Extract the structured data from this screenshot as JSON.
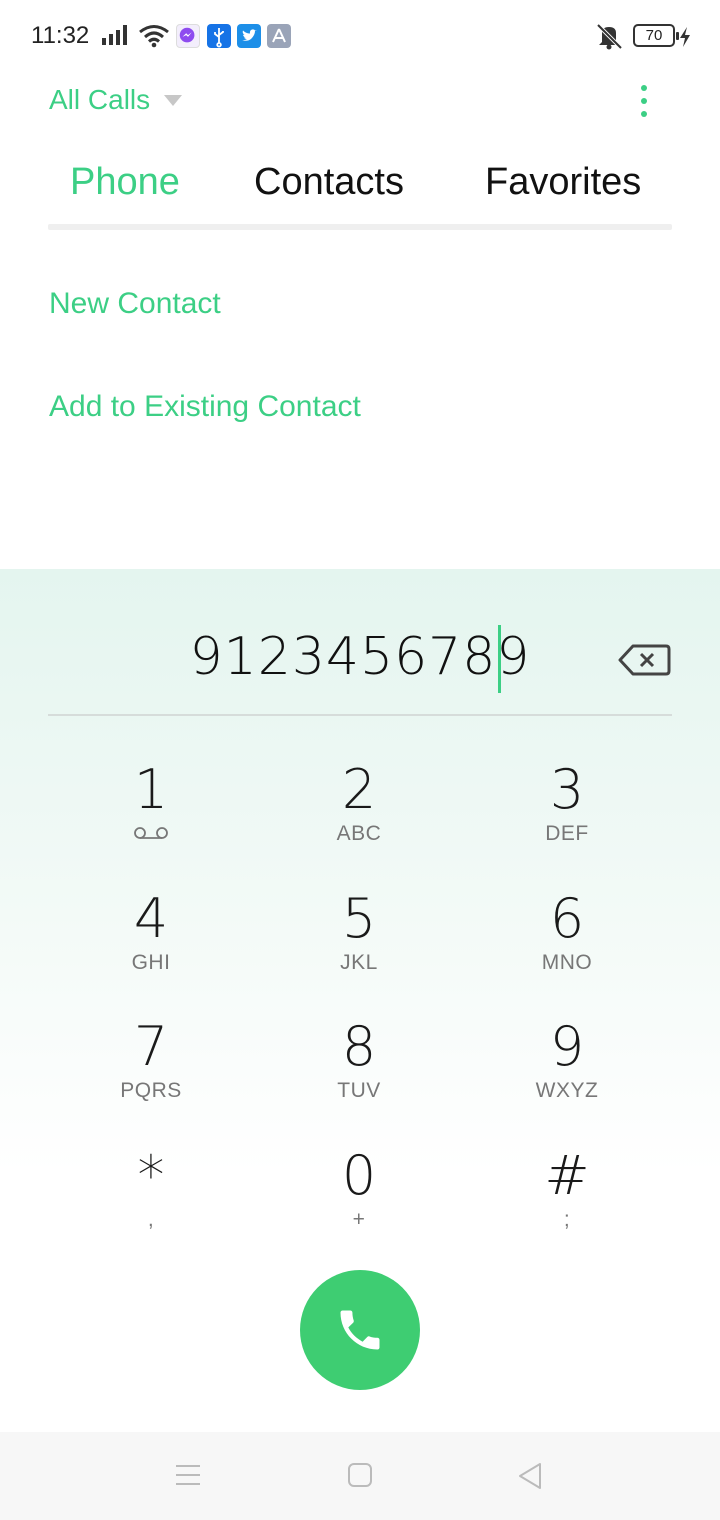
{
  "status_bar": {
    "time": "11:32",
    "battery": "70",
    "icons": [
      "signal-icon",
      "wifi-icon",
      "messenger-icon",
      "usb-icon",
      "twitter-icon",
      "app-store-icon",
      "mute-icon",
      "battery-icon",
      "charging-icon"
    ]
  },
  "header": {
    "filter_label": "All Calls",
    "more_icon": "more-vert-icon"
  },
  "tabs": [
    {
      "label": "Phone",
      "active": true
    },
    {
      "label": "Contacts",
      "active": false
    },
    {
      "label": "Favorites",
      "active": false
    }
  ],
  "actions": {
    "new_contact": "New Contact",
    "add_existing": "Add to Existing Contact"
  },
  "dialer": {
    "number": "9123456789",
    "keys": [
      {
        "digit": "1",
        "letters": ""
      },
      {
        "digit": "2",
        "letters": "ABC"
      },
      {
        "digit": "3",
        "letters": "DEF"
      },
      {
        "digit": "4",
        "letters": "GHI"
      },
      {
        "digit": "5",
        "letters": "JKL"
      },
      {
        "digit": "6",
        "letters": "MNO"
      },
      {
        "digit": "7",
        "letters": "PQRS"
      },
      {
        "digit": "8",
        "letters": "TUV"
      },
      {
        "digit": "9",
        "letters": "WXYZ"
      },
      {
        "digit": "*",
        "letters": ","
      },
      {
        "digit": "0",
        "letters": "+"
      },
      {
        "digit": "#",
        "letters": ";"
      }
    ]
  },
  "colors": {
    "accent": "#3ccf85",
    "call_button": "#3ecd72",
    "dialpad_bg_top": "#e4f5ef"
  }
}
